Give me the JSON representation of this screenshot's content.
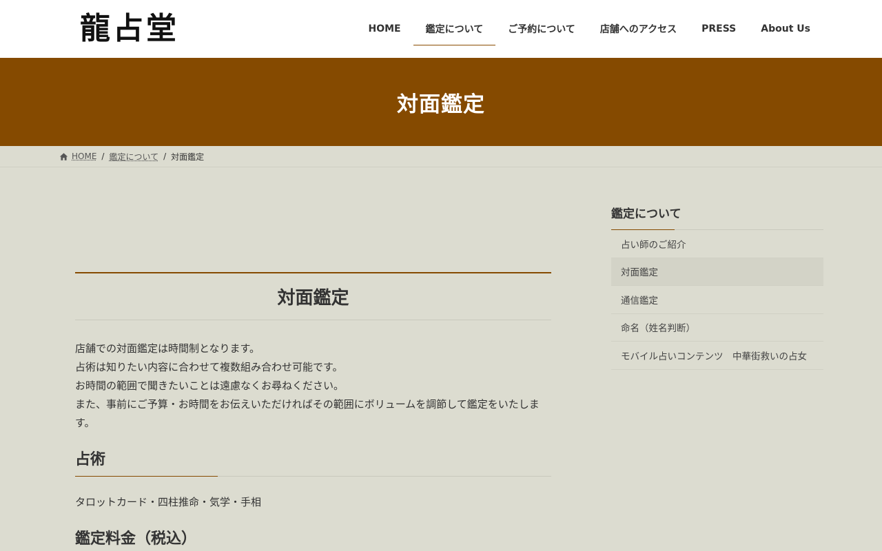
{
  "site": {
    "logo_text": "龍占堂"
  },
  "nav": {
    "items": [
      {
        "label": "HOME"
      },
      {
        "label": "鑑定について"
      },
      {
        "label": "ご予約について"
      },
      {
        "label": "店舗へのアクセス"
      },
      {
        "label": "PRESS"
      },
      {
        "label": "About Us"
      }
    ],
    "active_index": 1
  },
  "banner": {
    "title": "対面鑑定"
  },
  "breadcrumb": {
    "home_icon": "home-icon",
    "items": [
      {
        "label": "HOME"
      },
      {
        "label": "鑑定について"
      },
      {
        "label": "対面鑑定"
      }
    ],
    "separator": "/"
  },
  "article": {
    "title": "対面鑑定",
    "intro_lines": [
      "店舗での対面鑑定は時間制となります。",
      "占術は知りたい内容に合わせて複数組み合わせ可能です。",
      "お時間の範囲で聞きたいことは遠慮なくお尋ねください。",
      "また、事前にご予算・お時間をお伝えいただければその範囲にボリュームを調節して鑑定をいたします。"
    ],
    "section1": {
      "heading": "占術",
      "text": "タロットカード・四柱推命・気学・手相"
    },
    "section2": {
      "heading": "鑑定料金（税込）"
    }
  },
  "sidebar": {
    "title": "鑑定について",
    "items": [
      {
        "label": "占い師のご紹介"
      },
      {
        "label": "対面鑑定"
      },
      {
        "label": "通信鑑定"
      },
      {
        "label": "命名（姓名判断）"
      },
      {
        "label": "モバイル占いコンテンツ　中華街救いの占女"
      }
    ],
    "current_index": 1
  },
  "colors": {
    "brand_brown": "#854a00",
    "page_background": "#dcdcd0",
    "header_background": "#ffffff"
  }
}
